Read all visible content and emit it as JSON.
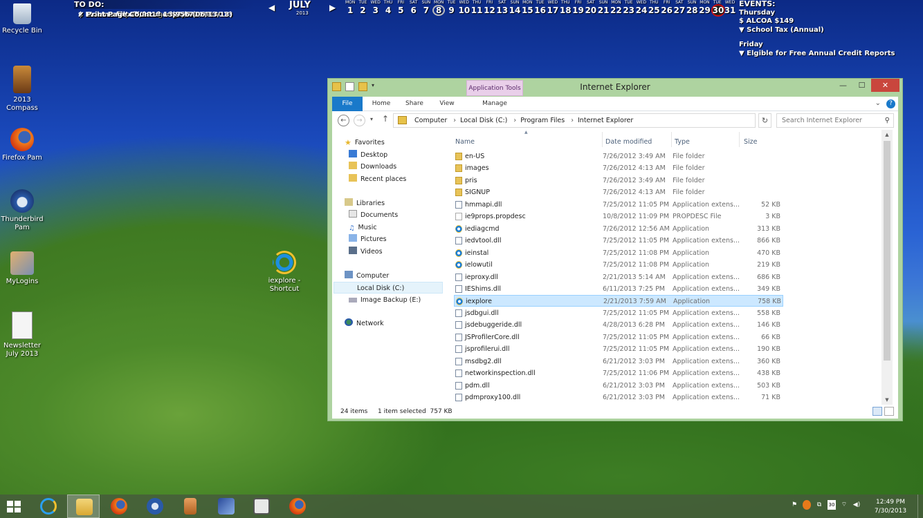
{
  "desktop_icons": [
    {
      "label": "Recycle Bin"
    },
    {
      "label": "2013 Compass"
    },
    {
      "label": "Firefox Pam"
    },
    {
      "label": "Thunderbird Pam"
    },
    {
      "label": "MyLogins"
    },
    {
      "label": "Newsletter July 2013"
    },
    {
      "label": "iexplore - Shortcut"
    }
  ],
  "todo": {
    "header": "TO DO:",
    "items": [
      "Heat-Pump filter changed 07/07/2013",
      "Holmes filter changed 05/14/2013",
      "Income for 07/2012 = $2,558",
      "Income for 08/2012 = $2,803",
      "Income for 09/2012 = $3,579",
      "Income for 10/2013 = $3,070",
      "Print Page Count = 13,956 (06/13/13)"
    ]
  },
  "calendar": {
    "month": "JULY",
    "year": "2013",
    "days": [
      {
        "n": "MON",
        "d": "1"
      },
      {
        "n": "TUE",
        "d": "2"
      },
      {
        "n": "WED",
        "d": "3"
      },
      {
        "n": "THU",
        "d": "4"
      },
      {
        "n": "FRI",
        "d": "5"
      },
      {
        "n": "SAT",
        "d": "6"
      },
      {
        "n": "SUN",
        "d": "7"
      },
      {
        "n": "MON",
        "d": "8"
      },
      {
        "n": "TUE",
        "d": "9"
      },
      {
        "n": "WED",
        "d": "10"
      },
      {
        "n": "THU",
        "d": "11"
      },
      {
        "n": "FRI",
        "d": "12"
      },
      {
        "n": "SAT",
        "d": "13"
      },
      {
        "n": "SUN",
        "d": "14"
      },
      {
        "n": "MON",
        "d": "15"
      },
      {
        "n": "TUE",
        "d": "16"
      },
      {
        "n": "WED",
        "d": "17"
      },
      {
        "n": "THU",
        "d": "18"
      },
      {
        "n": "FRI",
        "d": "19"
      },
      {
        "n": "SAT",
        "d": "20"
      },
      {
        "n": "SUN",
        "d": "21"
      },
      {
        "n": "MON",
        "d": "22"
      },
      {
        "n": "TUE",
        "d": "23"
      },
      {
        "n": "WED",
        "d": "24"
      },
      {
        "n": "THU",
        "d": "25"
      },
      {
        "n": "FRI",
        "d": "26"
      },
      {
        "n": "SAT",
        "d": "27"
      },
      {
        "n": "SUN",
        "d": "28"
      },
      {
        "n": "MON",
        "d": "29"
      },
      {
        "n": "TUE",
        "d": "30"
      },
      {
        "n": "WED",
        "d": "31"
      }
    ]
  },
  "events": {
    "header": "EVENTS:",
    "groups": [
      {
        "day": "Thursday",
        "items": [
          "ALCOA $149",
          "School Tax (Annual)"
        ]
      },
      {
        "day": "Friday",
        "items": [
          "Elgible for Free Annual Credit Reports"
        ]
      }
    ]
  },
  "explorer": {
    "title": "Internet Explorer",
    "app_tools": "Application Tools",
    "tabs": [
      "File",
      "Home",
      "Share",
      "View",
      "Manage"
    ],
    "breadcrumb": [
      "Computer",
      "Local Disk (C:)",
      "Program Files",
      "Internet Explorer"
    ],
    "search_placeholder": "Search Internet Explorer",
    "nav": {
      "favorites": "Favorites",
      "desktop": "Desktop",
      "downloads": "Downloads",
      "recent": "Recent places",
      "libraries": "Libraries",
      "documents": "Documents",
      "music": "Music",
      "pictures": "Pictures",
      "videos": "Videos",
      "computer": "Computer",
      "local_disk": "Local Disk (C:)",
      "image_backup": "Image Backup (E:)",
      "network": "Network"
    },
    "columns": [
      "Name",
      "Date modified",
      "Type",
      "Size"
    ],
    "files": [
      {
        "name": "en-US",
        "date": "7/26/2012 3:49 AM",
        "type": "File folder",
        "size": "",
        "icon": "folder"
      },
      {
        "name": "images",
        "date": "7/26/2012 4:13 AM",
        "type": "File folder",
        "size": "",
        "icon": "folder"
      },
      {
        "name": "pris",
        "date": "7/26/2012 3:49 AM",
        "type": "File folder",
        "size": "",
        "icon": "folder"
      },
      {
        "name": "SIGNUP",
        "date": "7/26/2012 4:13 AM",
        "type": "File folder",
        "size": "",
        "icon": "folder"
      },
      {
        "name": "hmmapi.dll",
        "date": "7/25/2012 11:05 PM",
        "type": "Application extens...",
        "size": "52 KB",
        "icon": "dll"
      },
      {
        "name": "ie9props.propdesc",
        "date": "10/8/2012 11:09 PM",
        "type": "PROPDESC File",
        "size": "3 KB",
        "icon": "file"
      },
      {
        "name": "iediagcmd",
        "date": "7/26/2012 12:56 AM",
        "type": "Application",
        "size": "313 KB",
        "icon": "ie"
      },
      {
        "name": "iedvtool.dll",
        "date": "7/25/2012 11:05 PM",
        "type": "Application extens...",
        "size": "866 KB",
        "icon": "dll"
      },
      {
        "name": "ieinstal",
        "date": "7/25/2012 11:08 PM",
        "type": "Application",
        "size": "470 KB",
        "icon": "ie"
      },
      {
        "name": "ielowutil",
        "date": "7/25/2012 11:08 PM",
        "type": "Application",
        "size": "219 KB",
        "icon": "ie"
      },
      {
        "name": "ieproxy.dll",
        "date": "2/21/2013 5:14 AM",
        "type": "Application extens...",
        "size": "686 KB",
        "icon": "dll"
      },
      {
        "name": "IEShims.dll",
        "date": "6/11/2013 7:25 PM",
        "type": "Application extens...",
        "size": "349 KB",
        "icon": "dll"
      },
      {
        "name": "iexplore",
        "date": "2/21/2013 7:59 AM",
        "type": "Application",
        "size": "758 KB",
        "icon": "ie",
        "selected": true
      },
      {
        "name": "jsdbgui.dll",
        "date": "7/25/2012 11:05 PM",
        "type": "Application extens...",
        "size": "558 KB",
        "icon": "dll"
      },
      {
        "name": "jsdebuggeride.dll",
        "date": "4/28/2013 6:28 PM",
        "type": "Application extens...",
        "size": "146 KB",
        "icon": "dll"
      },
      {
        "name": "JSProfilerCore.dll",
        "date": "7/25/2012 11:05 PM",
        "type": "Application extens...",
        "size": "66 KB",
        "icon": "dll"
      },
      {
        "name": "jsprofilerui.dll",
        "date": "7/25/2012 11:05 PM",
        "type": "Application extens...",
        "size": "190 KB",
        "icon": "dll"
      },
      {
        "name": "msdbg2.dll",
        "date": "6/21/2012 3:03 PM",
        "type": "Application extens...",
        "size": "360 KB",
        "icon": "dll"
      },
      {
        "name": "networkinspection.dll",
        "date": "7/25/2012 11:06 PM",
        "type": "Application extens...",
        "size": "438 KB",
        "icon": "dll"
      },
      {
        "name": "pdm.dll",
        "date": "6/21/2012 3:03 PM",
        "type": "Application extens...",
        "size": "503 KB",
        "icon": "dll"
      },
      {
        "name": "pdmproxy100.dll",
        "date": "6/21/2012 3:03 PM",
        "type": "Application extens...",
        "size": "71 KB",
        "icon": "dll"
      }
    ],
    "status": {
      "count": "24 items",
      "selection": "1 item selected  757 KB"
    }
  },
  "taskbar": {
    "apps": [
      "start",
      "internet-explorer",
      "file-explorer",
      "firefox",
      "thunderbird",
      "jar-app",
      "notepad-app",
      "video-app",
      "firefox-2"
    ],
    "clock": {
      "time": "12:49 PM",
      "date": "7/30/2013"
    }
  }
}
